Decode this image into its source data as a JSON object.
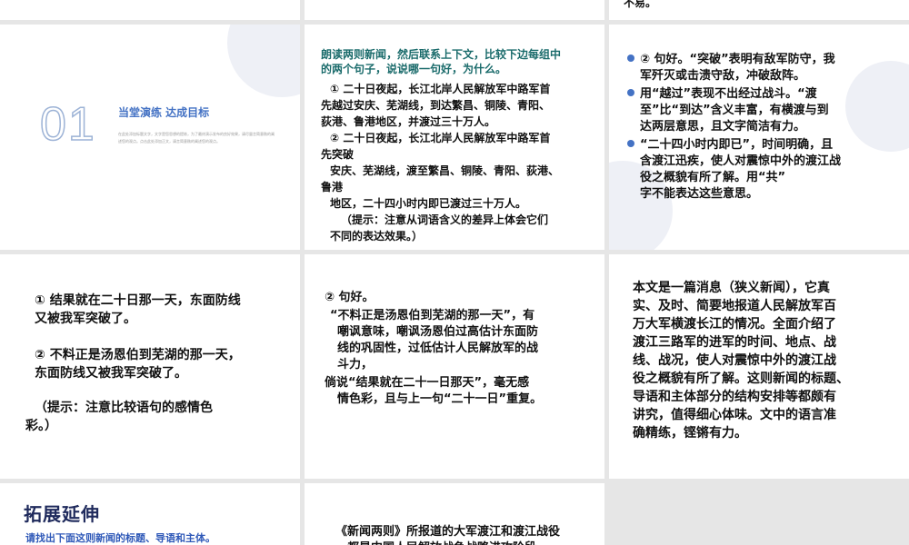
{
  "row0": {
    "right_fragment": "不易。"
  },
  "slide_section": {
    "number": "01",
    "title": "当堂演练 达成目标",
    "desc_line1": "在此处添加标题文字，文字是您思想的提炼，为了最终演示发布的良好效果，请尽量言简意赅的阐",
    "desc_line2": "述您的观点。点击此处添加正文，请言简意赅的阐述您的观点。"
  },
  "slide_question": {
    "prompt_line1": "朗读两则新闻，然后联系上下文，比较下边每组中",
    "prompt_line2": "的两个句子，说说哪一句好，为什么。",
    "lines": [
      "① 二十日夜起，长江北岸人民解放军中路军首",
      "先越过安庆、芜湖线，到达繁昌、铜陵、青阳、",
      "荻港、鲁港地区，并渡过三十万人。",
      "② 二十日夜起，长江北岸人民解放军中路军首",
      "先突破",
      "安庆、芜湖线，渡至繁昌、铜陵、青阳、荻港、",
      "鲁港",
      "地区，二十四小时内即已渡过三十万人。",
      "（提示：注意从词语含义的差异上体会它们",
      "不同的表达效果。）"
    ]
  },
  "slide_answer1": {
    "bullets": [
      [
        "② 句好。“突破”表明有敌军防守，我",
        "军歼灭或击溃守敌，冲破敌阵。"
      ],
      [
        "用“越过”表现不出经过战斗。“渡",
        "至”比“到达”含义丰富，有横渡与到",
        "达两层意思，且文字简洁有力。"
      ],
      [
        "“二十四小时内即已”，时间明确，且",
        "含渡江迅疾，使人对震惊中外的渡江战",
        "役之概貌有所了解。用“共”",
        "字不能表达这些意思。"
      ]
    ]
  },
  "slide_compare": {
    "line1a": "① 结果就在二十日那一天，东面防线",
    "line1b": "又被我军突破了。",
    "line2a": "② 不料正是汤恩伯到芜湖的那一天，",
    "line2b": "东面防线又被我军突破了。",
    "hint_a": "（提示：注意比较语句的感情色",
    "hint_b": "彩。）"
  },
  "slide_answer2": {
    "lines": [
      "② 句好。",
      "“不料正是汤恩伯到芜湖的那一天”，有",
      "嘲讽意味，嘲讽汤恩伯过高估计东面防",
      "线的巩固性，过低估计人民解放军的战",
      "斗力，",
      "倘说“结果就在二十一日那天”，毫无感",
      "情色彩，且与上一句“二十一日”重复。"
    ]
  },
  "slide_summary": {
    "lines": [
      "本文是一篇消息（狭义新闻），它真",
      "实、及时、简要地报道人民解放军百",
      "万大军横渡长江的情况。全面介绍了",
      "渡江三路军的进军的时间、地点、战",
      "线、战况，使人对震惊中外的渡江战",
      "役之概貌有所了解。这则新闻的标题、",
      "导语和主体部分的结构安排等都颇有",
      "讲究，值得细心体味。文中的语言准",
      "确精练，铿锵有力。"
    ]
  },
  "slide_extend": {
    "title": "拓展延伸",
    "subtitle": "请找出下面这则新闻的标题、导语和主体。"
  },
  "slide_news": {
    "line1": "《新闻两则》所报道的大军渡江和渡江战役",
    "line2": "，都是中国人民解放战争战略进攻阶段"
  },
  "colors": {
    "accent_blue": "#4472c4",
    "teal": "#1a6b6b",
    "number_outline": "#9db3d6"
  }
}
